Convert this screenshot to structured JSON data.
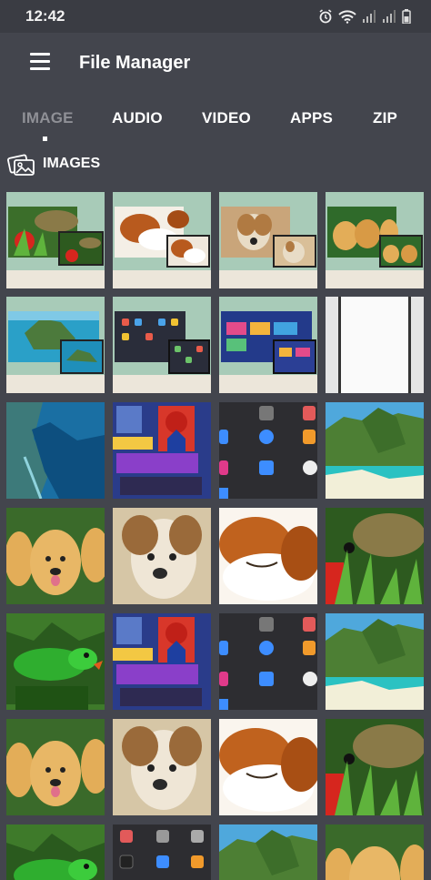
{
  "status_bar": {
    "time": "12:42",
    "icons": [
      "alarm-icon",
      "wifi-icon",
      "signal-icon",
      "signal-icon",
      "battery-icon"
    ]
  },
  "app_bar": {
    "menu_icon": "hamburger-menu-icon",
    "title": "File Manager"
  },
  "tabs": [
    {
      "label": "IMAGE",
      "active": true
    },
    {
      "label": "AUDIO",
      "active": false
    },
    {
      "label": "VIDEO",
      "active": false
    },
    {
      "label": "APPS",
      "active": false
    },
    {
      "label": "ZIP",
      "active": false
    }
  ],
  "section": {
    "icon": "images-icon",
    "label": "IMAGES"
  },
  "colors": {
    "background": "#43454d",
    "status_bar": "#3a3c43",
    "tab_inactive": "#ffffff",
    "tab_active": "#8f9096"
  },
  "thumbnails": [
    "mockup-strawberry-lizard",
    "mockup-puppy",
    "mockup-puppy-face",
    "mockup-golden-puppies",
    "mockup-island",
    "mockup-app-grid",
    "mockup-tv-app",
    "blank-white-page",
    "satellite-coast",
    "game-spiderman",
    "phone-app-grid",
    "tropical-island",
    "golden-puppies",
    "puppy-face",
    "sleeping-puppy",
    "lizard-strawberry",
    "green-parrot",
    "game-spiderman",
    "phone-app-grid",
    "tropical-island",
    "golden-puppies",
    "puppy-face",
    "sleeping-puppy",
    "lizard-strawberry",
    "green-parrot",
    "phone-app-grid",
    "tropical-island",
    "golden-puppies"
  ]
}
